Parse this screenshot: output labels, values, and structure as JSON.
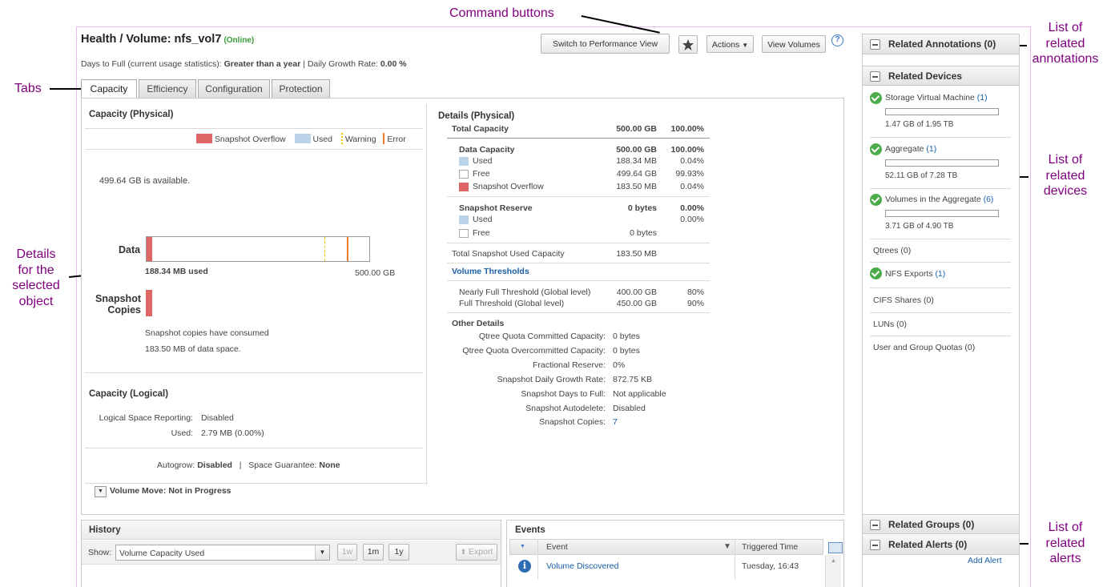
{
  "callouts": {
    "command_buttons": "Command buttons",
    "tabs": "Tabs",
    "details": [
      "Details",
      "for the",
      "selected",
      "object"
    ],
    "annotations": [
      "List of",
      "related",
      "annotations"
    ],
    "devices": [
      "List of",
      "related",
      "devices"
    ],
    "alerts": [
      "List of",
      "related",
      "alerts"
    ]
  },
  "header": {
    "title": "Health / Volume: nfs_vol7",
    "status": "(Online)",
    "days_label": "Days to Full (current usage statistics):",
    "days_value": "Greater than a year",
    "growth_label": "| Daily Growth Rate:",
    "growth_value": "0.00 %"
  },
  "toolbar": {
    "switch_perf": "Switch to Performance View",
    "actions": "Actions",
    "view_volumes": "View Volumes",
    "help": "?"
  },
  "tabs": [
    "Capacity",
    "Efficiency",
    "Configuration",
    "Protection"
  ],
  "capacity_physical": {
    "title": "Capacity (Physical)",
    "legend": [
      "Snapshot Overflow",
      "Used",
      "Warning",
      "Error"
    ],
    "available": "499.64 GB is available.",
    "data_label": "Data",
    "data_used": "188.34 MB used",
    "data_total": "500.00 GB",
    "data_used_fraction": 0.0004,
    "warning_fraction": 0.8,
    "error_fraction": 0.9,
    "snapshot_label": [
      "Snapshot",
      "Copies"
    ],
    "snapshot_text": [
      "Snapshot copies have consumed",
      "183.50 MB of data space."
    ]
  },
  "capacity_logical": {
    "title": "Capacity (Logical)",
    "lsr_label": "Logical Space Reporting:",
    "lsr_value": "Disabled",
    "used_label": "Used:",
    "used_value": "2.79 MB (0.00%)",
    "autogrow_label": "Autogrow:",
    "autogrow_value": "Disabled",
    "sep": "|",
    "guarantee_label": "Space Guarantee:",
    "guarantee_value": "None",
    "volume_move": "Volume Move: Not in Progress"
  },
  "details": {
    "title": "Details (Physical)",
    "total_label": "Total Capacity",
    "total_value": "500.00 GB",
    "total_pct": "100.00%",
    "data_cap_label": "Data Capacity",
    "data_cap_value": "500.00 GB",
    "data_cap_pct": "100.00%",
    "rows": [
      {
        "label": "Used",
        "value": "188.34 MB",
        "pct": "0.04%"
      },
      {
        "label": "Free",
        "value": "499.64 GB",
        "pct": "99.93%"
      },
      {
        "label": "Snapshot Overflow",
        "value": "183.50 MB",
        "pct": "0.04%"
      }
    ],
    "reserve_label": "Snapshot Reserve",
    "reserve_value": "0 bytes",
    "reserve_pct": "0.00%",
    "reserve_used_label": "Used",
    "reserve_used_pct": "0.00%",
    "reserve_free_label": "Free",
    "reserve_free_value": "0 bytes",
    "tsuc_label": "Total Snapshot Used Capacity",
    "tsuc_value": "183.50 MB",
    "thresholds_title": "Volume Thresholds",
    "thresholds": [
      {
        "label": "Nearly Full Threshold (Global level)",
        "value": "400.00 GB",
        "pct": "80%"
      },
      {
        "label": "Full Threshold (Global level)",
        "value": "450.00 GB",
        "pct": "90%"
      }
    ],
    "other_title": "Other Details",
    "other": [
      {
        "label": "Qtree Quota Committed Capacity:",
        "value": "0 bytes"
      },
      {
        "label": "Qtree Quota Overcommitted Capacity:",
        "value": "0 bytes"
      },
      {
        "label": "Fractional Reserve:",
        "value": "0%"
      },
      {
        "label": "Snapshot Daily Growth Rate:",
        "value": "872.75 KB"
      },
      {
        "label": "Snapshot Days to Full:",
        "value": "Not applicable"
      },
      {
        "label": "Snapshot Autodelete:",
        "value": "Disabled"
      },
      {
        "label": "Snapshot Copies:",
        "value": "7"
      }
    ]
  },
  "history": {
    "title": "History",
    "show_label": "Show:",
    "select_value": "Volume Capacity Used",
    "ranges": [
      "1w",
      "1m",
      "1y"
    ],
    "export": "Export"
  },
  "events": {
    "title": "Events",
    "col_event": "Event",
    "col_time": "Triggered Time",
    "row_event": "Volume Discovered",
    "row_time": "Tuesday, 16:43"
  },
  "sidebar": {
    "annotations": "Related Annotations (0)",
    "devices": "Related Devices",
    "svm_label": "Storage Virtual Machine",
    "svm_count": "(1)",
    "svm_usage": "1.47 GB of 1.95 TB",
    "aggr_label": "Aggregate",
    "aggr_count": "(1)",
    "aggr_usage": "52.11 GB of 7.28 TB",
    "vols_label": "Volumes in the Aggregate",
    "vols_count": "(6)",
    "vols_usage": "3.71 GB of 4.90 TB",
    "qtrees": "Qtrees (0)",
    "nfs_label": "NFS Exports",
    "nfs_count": "(1)",
    "cifs": "CIFS Shares (0)",
    "luns": "LUNs (0)",
    "quotas": "User and Group Quotas (0)",
    "groups": "Related Groups (0)",
    "alerts": "Related Alerts (0)",
    "add_alert": "Add Alert"
  },
  "colors": {
    "snapshot_overflow": "#e06565",
    "used": "#bcd4ea",
    "warning": "#f2c200",
    "error": "#f07a2a",
    "callout": "#800080",
    "link": "#1a5fa8"
  }
}
